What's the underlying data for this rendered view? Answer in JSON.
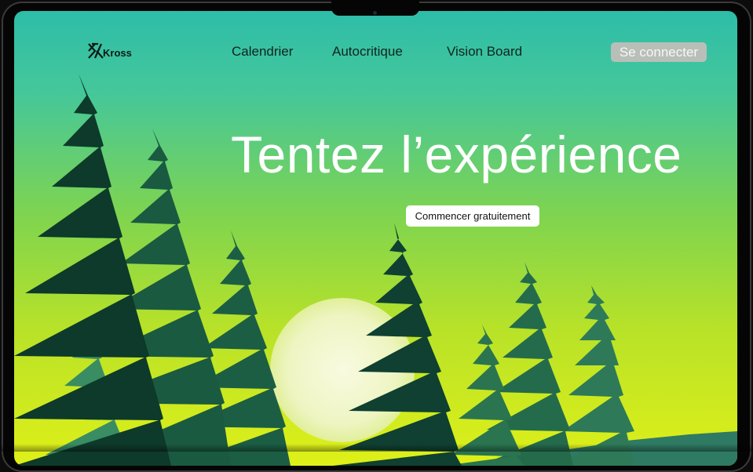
{
  "brand": {
    "name": "Kross",
    "logo_icon": "kross-logo-icon"
  },
  "nav": {
    "links": [
      {
        "label": "Calendrier"
      },
      {
        "label": "Autocritique"
      },
      {
        "label": "Vision Board"
      }
    ],
    "login_label": "Se connecter"
  },
  "hero": {
    "title": "Tentez l’expérience",
    "cta_label": "Commencer gratuitement"
  },
  "colors": {
    "sky_top": "#2dbda9",
    "sky_bottom": "#dff018",
    "sun": "#f3f7cf",
    "tree_dark": "#0e3a2c",
    "tree_mid": "#1f6b4f",
    "tree_light": "#3f9a6a"
  }
}
